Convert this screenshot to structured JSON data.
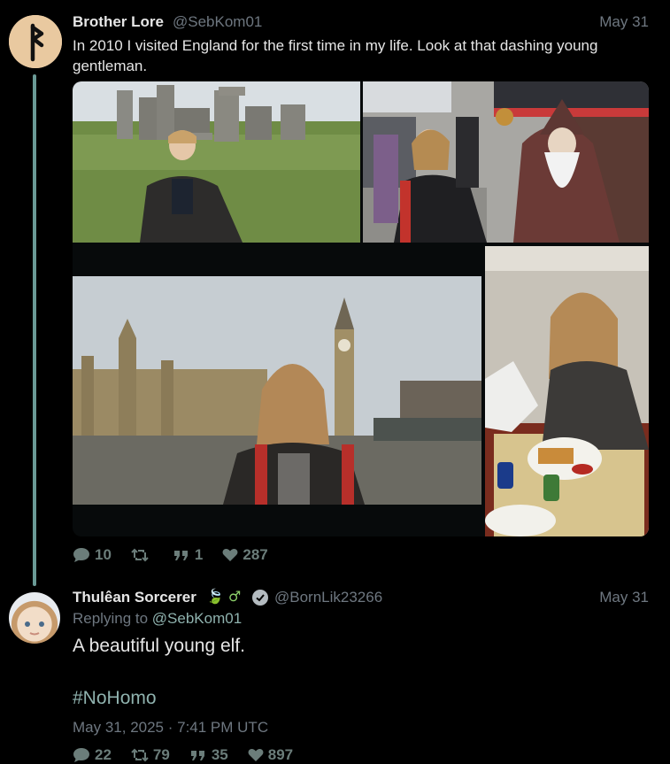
{
  "tweet": {
    "author_name": "Brother Lore",
    "handle": "@SebKom01",
    "date": "May 31",
    "text": "In 2010 I visited England for the first time in my life. Look at that dashing young gentleman.",
    "stats": {
      "replies": "10",
      "retweets": "",
      "quotes": "1",
      "likes": "287"
    }
  },
  "reply": {
    "author_name": "Thulêan Sorcerer",
    "name_emoji": "🍃 ♂",
    "handle": "@BornLik23266",
    "date": "May 31",
    "replying_label": "Replying to",
    "replying_handle": "@SebKom01",
    "text": "A beautiful young elf.",
    "hashtag": "#NoHomo",
    "timestamp": "May 31, 2025 · 7:41 PM UTC",
    "stats": {
      "replies": "22",
      "retweets": "79",
      "quotes": "35",
      "likes": "897"
    }
  },
  "icons": {
    "reply": "speech-bubble-icon",
    "retweet": "retweet-icon",
    "quote": "quote-icon",
    "like": "heart-icon",
    "verified": "verified-badge-icon"
  },
  "colors": {
    "background": "#000000",
    "thread_line": "#6a9a96",
    "accent": "#8fb2ae",
    "muted": "#6e7780"
  }
}
